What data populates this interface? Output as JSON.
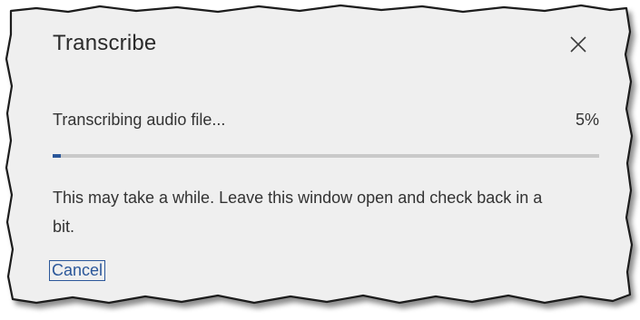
{
  "dialog": {
    "title": "Transcribe",
    "close_icon": "close-icon",
    "status_text": "Transcribing audio file...",
    "progress_percent_label": "5%",
    "progress_fraction": 0.015,
    "message": "This may take a while. Leave this window open and check back in a bit.",
    "cancel_label": "Cancel"
  },
  "colors": {
    "accent": "#2b579a",
    "panel_background": "#efefef",
    "track": "#c9c9c9"
  }
}
